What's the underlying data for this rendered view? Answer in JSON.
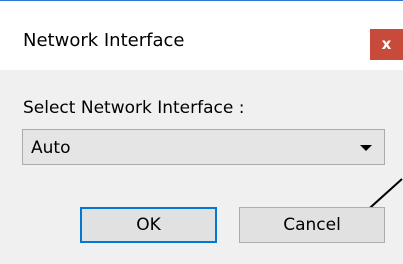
{
  "window": {
    "title": "Network Interface",
    "close_label": "x"
  },
  "content": {
    "select_label": "Select Network Interface :",
    "select_value": "Auto"
  },
  "buttons": {
    "ok_label": "OK",
    "cancel_label": "Cancel"
  },
  "icons": {
    "close": "close-icon",
    "dropdown": "chevron-down-icon",
    "annotation": "pointer-arrow"
  },
  "colors": {
    "title_bar": "#ffffff",
    "body": "#f0f0f0",
    "close_button": "#c74a3b",
    "default_button_border": "#0078d7",
    "window_border": "#2b78d4"
  }
}
